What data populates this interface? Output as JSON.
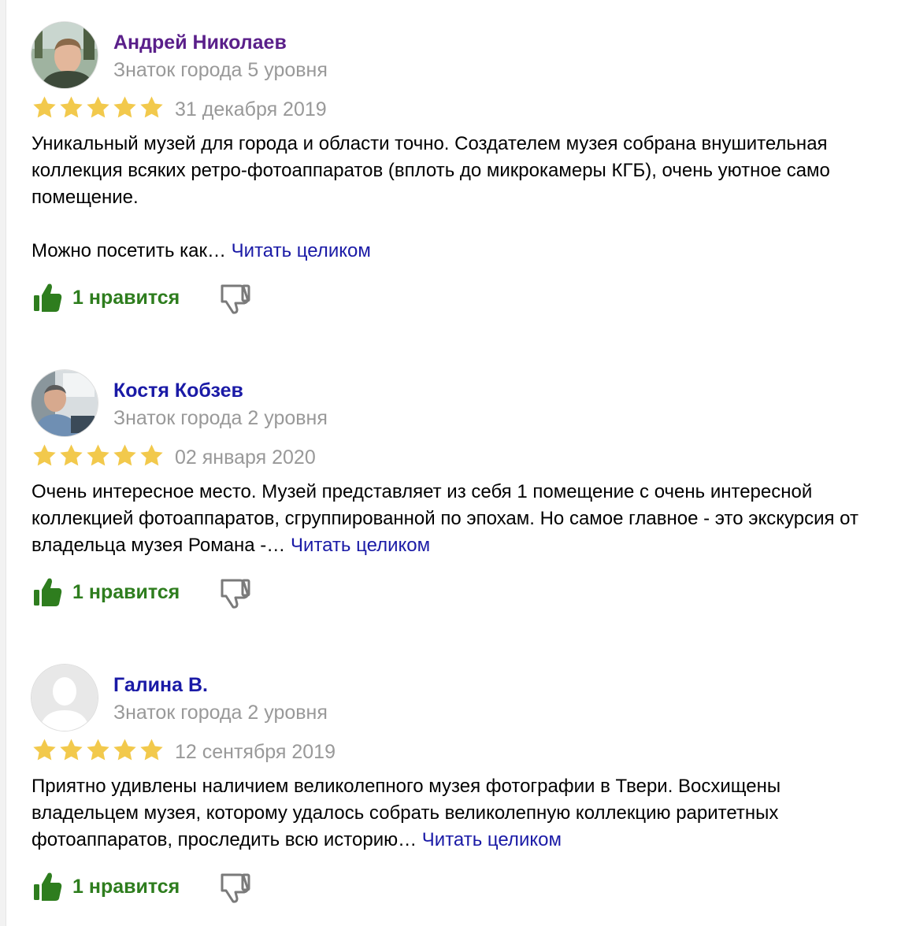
{
  "colors": {
    "name_visited": "#5a1f8a",
    "name_link": "#1a1aa6",
    "muted": "#999999",
    "star": "#f2c94c",
    "like": "#2e7d1e",
    "dislike_outline": "#7a7a7a"
  },
  "reviews": [
    {
      "author": "Андрей Николаев",
      "level": "Знаток города 5 уровня",
      "rating": 5,
      "date": "31 декабря 2019",
      "paragraphs": [
        "Уникальный музей для города и области точно. Создателем музея собрана внушительная коллекция всяких ретро-фотоаппаратов (вплоть до микрокамеры КГБ), очень уютное само помещение.",
        "Можно посетить как…"
      ],
      "read_more": "Читать целиком",
      "likes": "1 нравится",
      "avatar": "photo-avatar-icon"
    },
    {
      "author": "Костя Кобзев",
      "level": "Знаток города 2 уровня",
      "rating": 5,
      "date": "02 января 2020",
      "paragraphs": [
        "Очень интересное место. Музей представляет из себя 1 помещение с очень интересной коллекцией фотоаппаратов, сгруппированной по эпохам. Но самое главное - это экскурсия от владельца музея Романа -…"
      ],
      "read_more": "Читать целиком",
      "likes": "1 нравится",
      "avatar": "photo-avatar-icon"
    },
    {
      "author": "Галина В.",
      "level": "Знаток города 2 уровня",
      "rating": 5,
      "date": "12 сентября 2019",
      "paragraphs": [
        "Приятно удивлены наличием великолепного музея фотографии в Твери. Восхищены владельцем музея, которому удалось собрать великолепную коллекцию раритетных фотоаппаратов, проследить всю историю…"
      ],
      "read_more": "Читать целиком",
      "likes": "1 нравится",
      "avatar": "default-avatar-icon"
    }
  ]
}
